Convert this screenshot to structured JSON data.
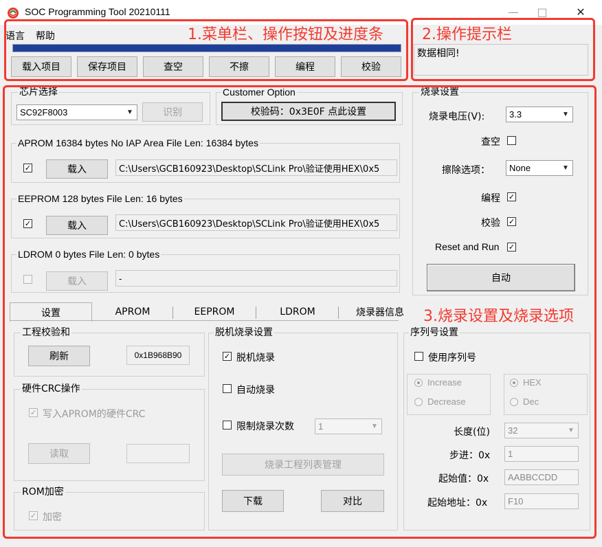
{
  "window": {
    "title": "SOC Programming Tool 20210111",
    "minimize": "—",
    "maximize": "□",
    "close": "✕"
  },
  "menu": [
    "语言",
    "帮助"
  ],
  "progress": {
    "value": 1.0
  },
  "toolbar": {
    "load": "载入项目",
    "save": "保存项目",
    "blank": "查空",
    "noerase": "不擦",
    "program": "编程",
    "verify": "校验"
  },
  "message": "数据相同!",
  "chip": {
    "title": "芯片选择",
    "selected": "SC92F8003",
    "identify": "识别"
  },
  "customer": {
    "title": "Customer Option",
    "checksum_button": "校验码：0x3E0F  点此设置"
  },
  "aprom": {
    "title": "APROM 16384 bytes  No IAP Area    File Len: 16384 bytes",
    "checked": "✓",
    "load": "载入",
    "path": "C:\\Users\\GCB160923\\Desktop\\SCLink Pro\\验证使用HEX\\0x5"
  },
  "eeprom": {
    "title": "EEPROM 128 bytes    File Len: 16 bytes",
    "checked": "✓",
    "load": "载入",
    "path": "C:\\Users\\GCB160923\\Desktop\\SCLink Pro\\验证使用HEX\\0x5"
  },
  "ldrom": {
    "title": "LDROM 0 bytes    File Len: 0 bytes",
    "load": "载入",
    "path": "-"
  },
  "burn": {
    "title": "烧录设置",
    "voltage_label": "烧录电压(V):",
    "voltage": "3.3",
    "blank_label": "查空",
    "erase_label": "擦除选项：",
    "erase": "None",
    "program_label": "编程",
    "verify_label": "校验",
    "reset_label": "Reset and Run",
    "check": "✓",
    "auto": "自动"
  },
  "tabs": [
    "设置",
    "APROM",
    "EEPROM",
    "LDROM",
    "烧录器信息"
  ],
  "checksum": {
    "title": "工程校验和",
    "refresh": "刷新",
    "value": "0x1B968B90"
  },
  "crc": {
    "title": "硬件CRC操作",
    "write_label": "写入APROM的硬件CRC",
    "check": "✓",
    "read": "读取"
  },
  "rom": {
    "title": "ROM加密",
    "encrypt": "加密",
    "check": "✓"
  },
  "offline": {
    "title": "脱机烧录设置",
    "offline_label": "脱机烧录",
    "check": "✓",
    "auto_label": "自动烧录",
    "limit_label": "限制烧录次数",
    "limit_value": "1",
    "manage": "烧录工程列表管理",
    "download": "下载",
    "compare": "对比"
  },
  "serial": {
    "title": "序列号设置",
    "use_label": "使用序列号",
    "increase": "Increase",
    "decrease": "Decrease",
    "hex": "HEX",
    "dec": "Dec",
    "length_label": "长度(位)",
    "length": "32",
    "step_label": "步进：0x",
    "step": "1",
    "start_label": "起始值：0x",
    "start": "AABBCCDD",
    "addr_label": "起始地址：0x",
    "addr": "F10"
  },
  "annotations": {
    "a1": "1.菜单栏、操作按钮及进度条",
    "a2": "2.操作提示栏",
    "a3": "3.烧录设置及烧录选项",
    "color": "#f23a2f"
  },
  "icons": {
    "app": "app-logo-icon",
    "combo": "▼"
  }
}
